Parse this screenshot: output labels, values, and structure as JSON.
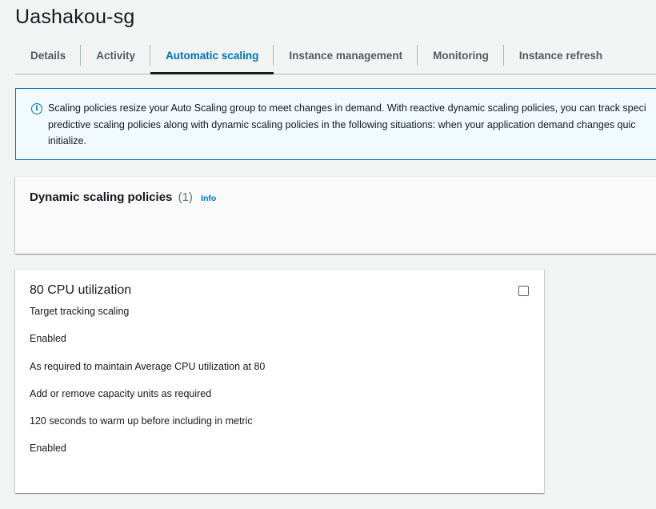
{
  "page": {
    "title": "Uashakou-sg"
  },
  "tabs": [
    {
      "label": "Details"
    },
    {
      "label": "Activity"
    },
    {
      "label": "Automatic scaling",
      "active": true
    },
    {
      "label": "Instance management"
    },
    {
      "label": "Monitoring"
    },
    {
      "label": "Instance refresh"
    }
  ],
  "alert": {
    "icon": "info-icon",
    "line1": "Scaling policies resize your Auto Scaling group to meet changes in demand. With reactive dynamic scaling policies, you can track speci",
    "line2": "predictive scaling policies along with dynamic scaling policies in the following situations: when your application demand changes quic",
    "line3": "initialize.",
    "accent_color": "#0073bb"
  },
  "dynamic_policies": {
    "title": "Dynamic scaling policies",
    "count": "(1)",
    "info_label": "Info"
  },
  "policy_card": {
    "name": "80 CPU utilization",
    "type": "Target tracking scaling",
    "status": "Enabled",
    "target": "As required to maintain Average CPU utilization at 80",
    "action": "Add or remove capacity units as required",
    "warmup": "120 seconds to warm up before including in metric",
    "scale_in": "Enabled",
    "selected": false
  }
}
